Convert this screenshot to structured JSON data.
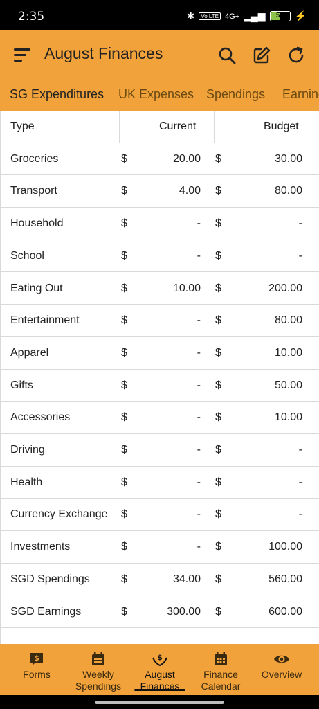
{
  "status": {
    "time": "2:35",
    "network": "4G+",
    "volte": "Vo LTE",
    "battery": "50"
  },
  "app": {
    "title": "August Finances",
    "icons": {
      "menu": "menu-icon",
      "search": "search-icon",
      "edit": "edit-icon",
      "refresh": "refresh-icon"
    }
  },
  "tabs": [
    "SG Expenditures",
    "UK Expenses",
    "Spendings",
    "Earnings"
  ],
  "table": {
    "headers": {
      "type": "Type",
      "current": "Current",
      "budget": "Budget"
    },
    "rows": [
      {
        "type": "Groceries",
        "cur_sym": "$",
        "current": "20.00",
        "bud_sym": "$",
        "budget": "30.00"
      },
      {
        "type": "Transport",
        "cur_sym": "$",
        "current": "4.00",
        "bud_sym": "$",
        "budget": "80.00"
      },
      {
        "type": "Household",
        "cur_sym": "$",
        "current": "-",
        "bud_sym": "$",
        "budget": "-"
      },
      {
        "type": "School",
        "cur_sym": "$",
        "current": "-",
        "bud_sym": "$",
        "budget": "-"
      },
      {
        "type": "Eating Out",
        "cur_sym": "$",
        "current": "10.00",
        "bud_sym": "$",
        "budget": "200.00"
      },
      {
        "type": "Entertainment",
        "cur_sym": "$",
        "current": "-",
        "bud_sym": "$",
        "budget": "80.00"
      },
      {
        "type": "Apparel",
        "cur_sym": "$",
        "current": "-",
        "bud_sym": "$",
        "budget": "10.00"
      },
      {
        "type": "Gifts",
        "cur_sym": "$",
        "current": "-",
        "bud_sym": "$",
        "budget": "50.00"
      },
      {
        "type": "Accessories",
        "cur_sym": "$",
        "current": "-",
        "bud_sym": "$",
        "budget": "10.00"
      },
      {
        "type": "Driving",
        "cur_sym": "$",
        "current": "-",
        "bud_sym": "$",
        "budget": "-"
      },
      {
        "type": "Health",
        "cur_sym": "$",
        "current": "-",
        "bud_sym": "$",
        "budget": "-"
      },
      {
        "type": "Currency Exchange",
        "cur_sym": "$",
        "current": "-",
        "bud_sym": "$",
        "budget": "-"
      },
      {
        "type": "Investments",
        "cur_sym": "$",
        "current": "-",
        "bud_sym": "$",
        "budget": "100.00"
      },
      {
        "type": "SGD Spendings",
        "cur_sym": "$",
        "current": "34.00",
        "bud_sym": "$",
        "budget": "560.00"
      },
      {
        "type": "SGD Earnings",
        "cur_sym": "$",
        "current": "300.00",
        "bud_sym": "$",
        "budget": "600.00"
      }
    ]
  },
  "bottom_nav": [
    {
      "label": "Forms",
      "icon": "dollar-note-icon"
    },
    {
      "label": "Weekly Spendings",
      "icon": "calendar-week-icon"
    },
    {
      "label": "August Finances",
      "icon": "hands-dollar-icon"
    },
    {
      "label": "Finance Calendar",
      "icon": "calendar-grid-icon"
    },
    {
      "label": "Overview",
      "icon": "eye-icon"
    }
  ],
  "colors": {
    "accent": "#f2a23a",
    "text": "#222222",
    "divider": "#d9d9d9"
  }
}
